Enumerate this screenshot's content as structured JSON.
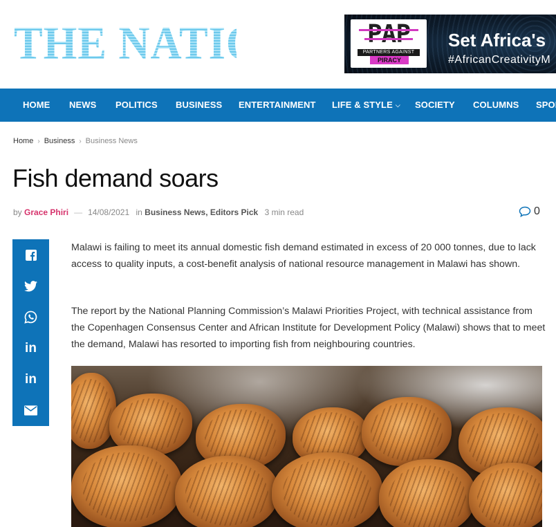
{
  "site": {
    "logo_text": "THE NATION"
  },
  "ad": {
    "brand_mark": "PAP",
    "brand_line1": "PARTNERS AGAINST",
    "brand_line2": "PIRACY",
    "headline": "Set Africa's",
    "tagline": "#AfricanCreativityM"
  },
  "nav": {
    "items": [
      "HOME",
      "NEWS",
      "POLITICS",
      "BUSINESS",
      "ENTERTAINMENT",
      "LIFE & STYLE",
      "SOCIETY",
      "COLUMNS",
      "SPOR"
    ]
  },
  "breadcrumb": {
    "home": "Home",
    "section": "Business",
    "current": "Business News"
  },
  "article": {
    "title": "Fish demand soars",
    "by_label": "by",
    "author": "Grace Phiri",
    "date": "14/08/2021",
    "in_label": "in",
    "categories": "Business News, Editors Pick",
    "read_time": "3 min read",
    "comment_count": "0",
    "paragraphs": [
      "Malawi is failing to meet its annual domestic fish demand estimated in excess of 20 000 tonnes, due to lack access to quality inputs, a cost-benefit analysis of  national resource management in Malawi has shown.",
      "The report by the National Planning Commission’s Malawi Priorities Project, with technical assistance from the Copenhagen Consensus Center and African Institute for Development Policy (Malawi) shows that to meet the demand, Malawi has resorted to importing fish from neighbouring countries."
    ]
  },
  "share": {
    "buttons": [
      {
        "icon": "facebook-icon",
        "glyph": "f"
      },
      {
        "icon": "twitter-icon",
        "glyph": "🐦"
      },
      {
        "icon": "whatsapp-icon",
        "glyph": "✆"
      },
      {
        "icon": "linkedin-icon",
        "glyph": "in"
      },
      {
        "icon": "linkedin-icon",
        "glyph": "in"
      },
      {
        "icon": "email-icon",
        "glyph": "✉"
      }
    ]
  },
  "colors": {
    "brand_blue": "#0e73b8",
    "author_pink": "#d6336c",
    "logo_blue": "#6dc9ec"
  }
}
